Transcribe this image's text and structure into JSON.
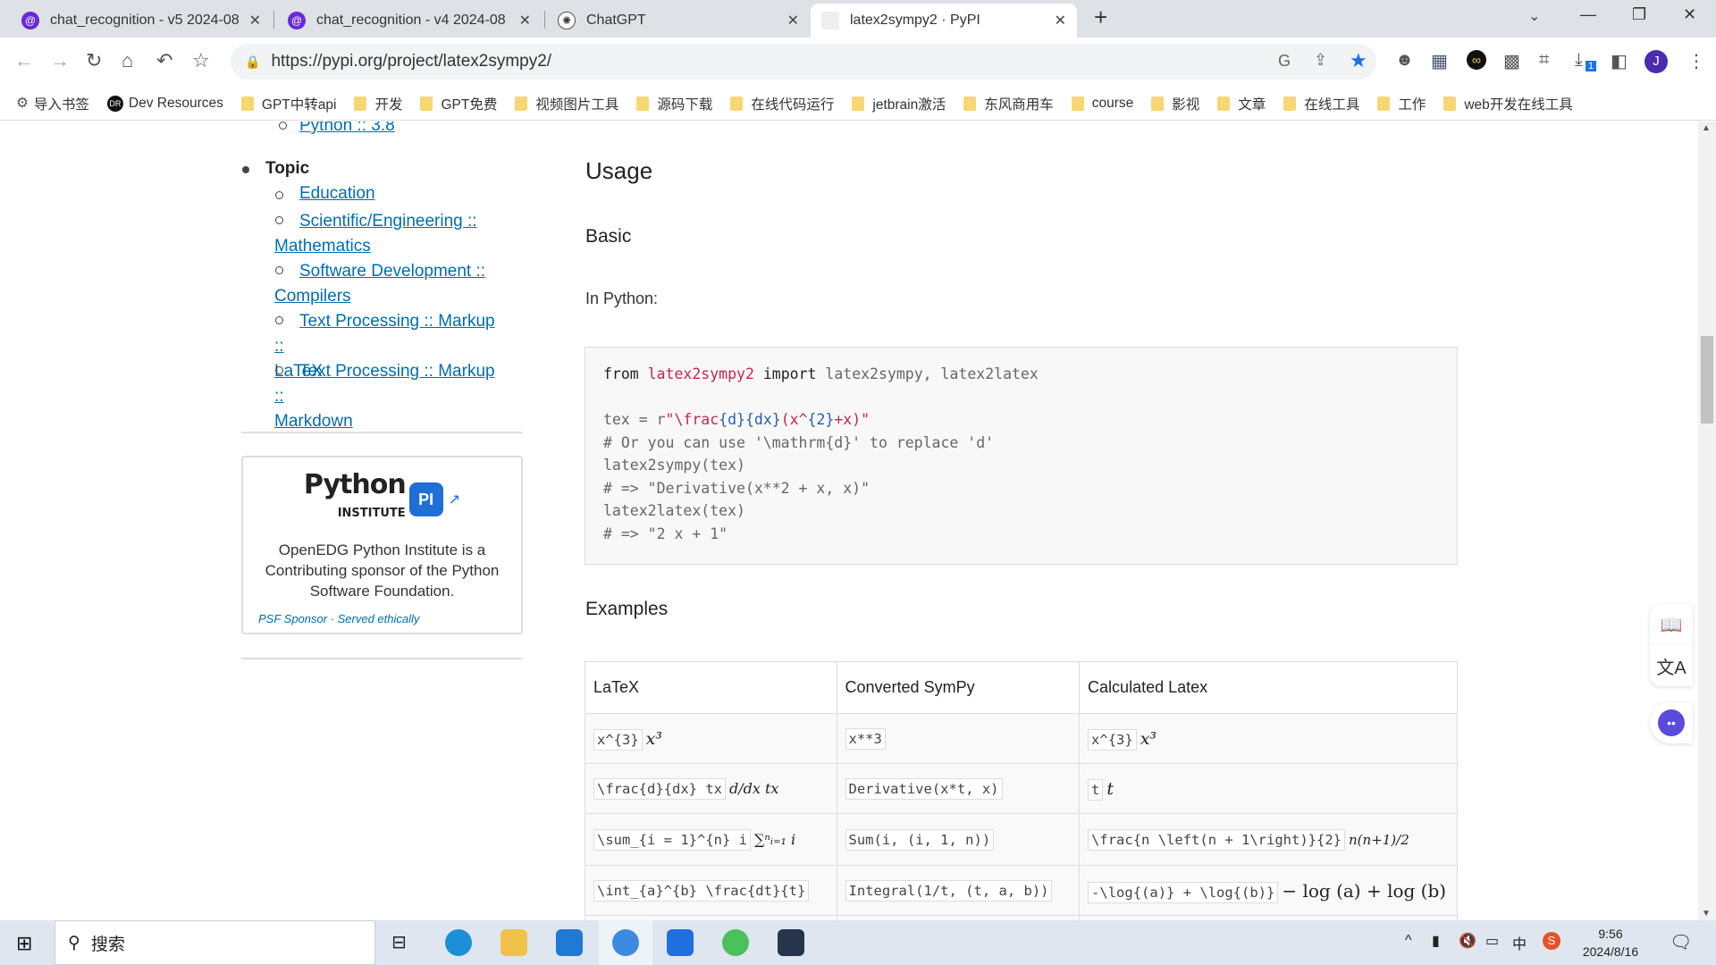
{
  "browser": {
    "tabs": [
      {
        "title": "chat_recognition - v5 2024-08",
        "icon": "circle-logo-icon",
        "active": false
      },
      {
        "title": "chat_recognition - v4 2024-08",
        "icon": "circle-logo-icon",
        "active": false
      },
      {
        "title": "ChatGPT",
        "icon": "openai-icon",
        "active": false
      },
      {
        "title": "latex2sympy2 · PyPI",
        "icon": "page-icon",
        "active": true
      }
    ],
    "new_tab": "+",
    "url": "https://pypi.org/project/latex2sympy2/",
    "profile_initial": "J",
    "download_badge": "1",
    "bookmarks": [
      {
        "label": "导入书签",
        "icon": "gear-icon"
      },
      {
        "label": "Dev Resources",
        "icon": "dev-icon"
      },
      {
        "label": "GPT中转api",
        "icon": "folder-icon"
      },
      {
        "label": "开发",
        "icon": "folder-icon"
      },
      {
        "label": "GPT免费",
        "icon": "folder-icon"
      },
      {
        "label": "视频图片工具",
        "icon": "folder-icon"
      },
      {
        "label": "源码下载",
        "icon": "folder-icon"
      },
      {
        "label": "在线代码运行",
        "icon": "folder-icon"
      },
      {
        "label": "jetbrain激活",
        "icon": "folder-icon"
      },
      {
        "label": "东风商用车",
        "icon": "folder-icon"
      },
      {
        "label": "course",
        "icon": "folder-icon"
      },
      {
        "label": "影视",
        "icon": "folder-icon"
      },
      {
        "label": "文章",
        "icon": "folder-icon"
      },
      {
        "label": "在线工具",
        "icon": "folder-icon"
      },
      {
        "label": "工作",
        "icon": "folder-icon"
      },
      {
        "label": "web开发在线工具",
        "icon": "folder-icon"
      }
    ]
  },
  "sidebar": {
    "python_version": "Python :: 3.8",
    "topic_label": "Topic",
    "topics": [
      [
        "Education"
      ],
      [
        "Scientific/Engineering ::",
        "Mathematics"
      ],
      [
        "Software Development ::",
        "Compilers"
      ],
      [
        "Text Processing :: Markup ::",
        "LaTeX"
      ],
      [
        "Text Processing :: Markup ::",
        "Markdown"
      ]
    ],
    "sponsor": {
      "logo_text": "Python INSTITUTE",
      "description": "OpenEDG Python Institute is a Contributing sponsor of the Python Software Foundation.",
      "footer": "PSF Sponsor · Served ethically"
    }
  },
  "main": {
    "usage_heading": "Usage",
    "basic_heading": "Basic",
    "intro": "In Python:",
    "code": {
      "l1a": "from",
      "l1b": "latex2sympy2",
      "l1c": "import",
      "l1d": "latex2sympy, latex2latex",
      "l2a": "tex = r",
      "l2b": "\"\\frac",
      "l2c": "{d}{dx}",
      "l2d": "(x^",
      "l2e": "{2}",
      "l2f": "+x)\"",
      "l3": "# Or you can use '\\mathrm{d}' to replace 'd'",
      "l4": "latex2sympy(tex)",
      "l5": "# => \"Derivative(x**2 + x, x)\"",
      "l6": "latex2latex(tex)",
      "l7": "# => \"2 x + 1\""
    },
    "examples_heading": "Examples",
    "table": {
      "headers": [
        "LaTeX",
        "Converted SymPy",
        "Calculated Latex"
      ],
      "rows": [
        {
          "latex": "x^{3}",
          "latex_render": "x³",
          "sympy": "x**3",
          "calc": "x^{3}",
          "calc_render": "x³"
        },
        {
          "latex": "\\frac{d}{dx} tx",
          "latex_render": "d/dx tx",
          "sympy": "Derivative(x*t, x)",
          "calc": "t",
          "calc_render": "t"
        },
        {
          "latex": "\\sum_{i = 1}^{n} i",
          "latex_render": "∑ⁿᵢ₌₁ i",
          "sympy": "Sum(i, (i, 1, n))",
          "calc": "\\frac{n \\left(n + 1\\right)}{2}",
          "calc_render": "n(n+1)/2"
        },
        {
          "latex": "\\int_{a}^{b} \\frac{dt}{t}",
          "latex_render": "",
          "sympy": "Integral(1/t, (t, a, b))",
          "calc": "-\\log{(a)} + \\log{(b)}",
          "calc_render": "− log (a) + log (b)"
        }
      ]
    }
  },
  "taskbar": {
    "search_placeholder": "搜索",
    "time": "9:56",
    "date": "2024/8/16"
  }
}
